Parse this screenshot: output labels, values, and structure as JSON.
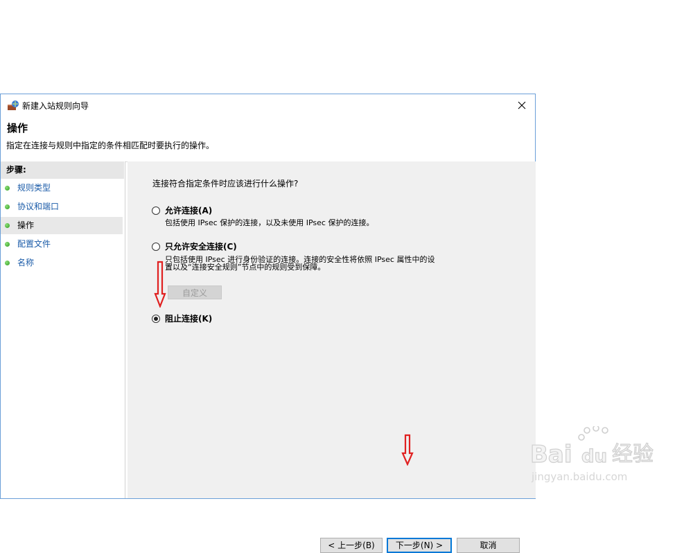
{
  "window": {
    "title": "新建入站规则向导",
    "close_glyph": "✕"
  },
  "header": {
    "title": "操作",
    "description": "指定在连接与规则中指定的条件相匹配时要执行的操作。"
  },
  "sidebar": {
    "steps_title": "步骤:",
    "items": [
      {
        "label": "规则类型"
      },
      {
        "label": "协议和端口"
      },
      {
        "label": "操作"
      },
      {
        "label": "配置文件"
      },
      {
        "label": "名称"
      }
    ]
  },
  "main": {
    "question": "连接符合指定条件时应该进行什么操作?",
    "options": [
      {
        "label": "允许连接(A)",
        "description": "包括使用 IPsec 保护的连接，以及未使用 IPsec 保护的连接。",
        "checked": false
      },
      {
        "label": "只允许安全连接(C)",
        "description_line1": "只包括使用 IPsec 进行身份验证的连接。连接的安全性将依照 IPsec 属性中的设",
        "description_line2": "置以及“连接安全规则”节点中的规则受到保障。",
        "checked": false
      },
      {
        "label": "阻止连接(K)",
        "checked": true
      }
    ],
    "customize_label": "自定义"
  },
  "footer": {
    "back_label": "< 上一步(B)",
    "next_label": "下一步(N) >",
    "cancel_label": "取消"
  },
  "watermark": {
    "brand_latin": "Bai",
    "brand_latin2": "du",
    "brand_cn": "经验",
    "url": "jingyan.baidu.com"
  },
  "colors": {
    "accent": "#0078d7",
    "annotation_arrow": "#e02020",
    "link": "#1a5ba8"
  }
}
